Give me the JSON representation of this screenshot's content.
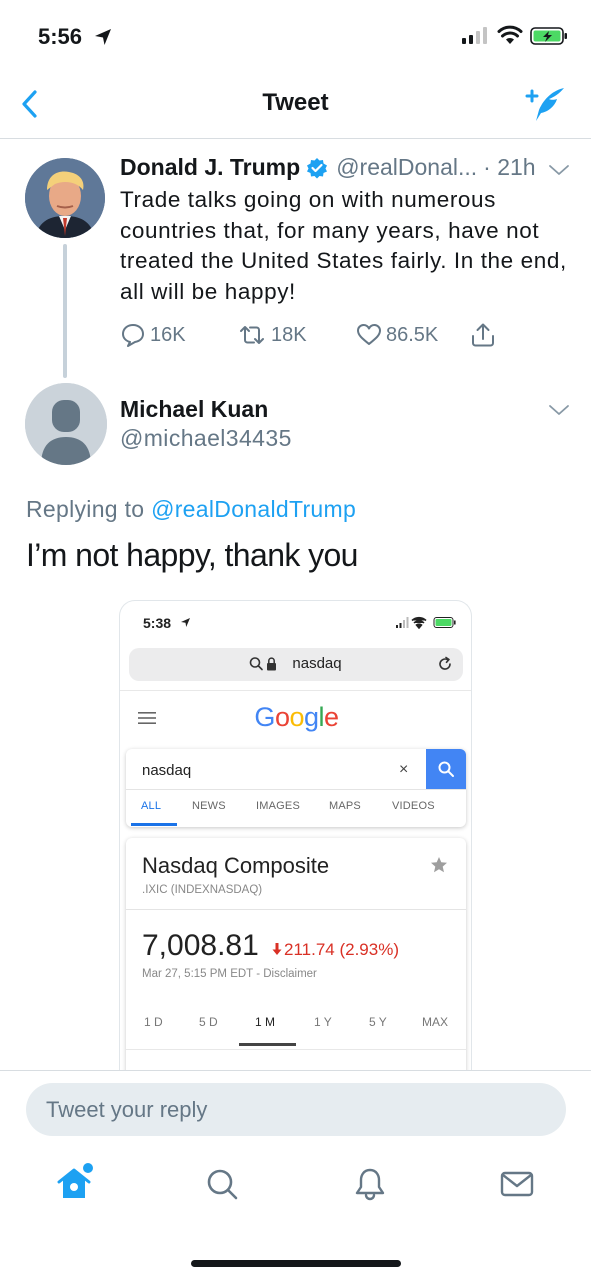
{
  "status_bar": {
    "time": "5:56",
    "icons": [
      "location-arrow-icon",
      "signal-icon",
      "wifi-icon",
      "battery-charging-icon"
    ]
  },
  "nav": {
    "title": "Tweet",
    "back_icon": "chevron-left-icon",
    "compose_icon": "compose-tweet-icon"
  },
  "tweet": {
    "name": "Donald J. Trump",
    "verified": true,
    "handle": "@realDonal...",
    "time": "· 21h",
    "text": "Trade talks going on with numerous countries that, for many years, have not treated the United States fairly. In the end, all will be happy!",
    "replies": "16K",
    "retweets": "18K",
    "likes": "86.5K"
  },
  "reply": {
    "name": "Michael Kuan",
    "handle": "@michael34435",
    "replying_prefix": "Replying to",
    "replying_to": "@realDonaldTrump",
    "text": "I’m not happy, thank you"
  },
  "media": {
    "time": "5:38",
    "url": "nasdaq",
    "logo": [
      "G",
      "o",
      "o",
      "g",
      "l",
      "e"
    ],
    "logo_colors": [
      "#4285f4",
      "#ea4335",
      "#fbbc05",
      "#4285f4",
      "#34a853",
      "#ea4335"
    ],
    "search_query": "nasdaq",
    "clear": "×",
    "tabs": [
      "ALL",
      "NEWS",
      "IMAGES",
      "MAPS",
      "VIDEOS"
    ],
    "active_tab": "ALL",
    "stock_name": "Nasdaq Composite",
    "ticker": ".IXIC (INDEXNASDAQ)",
    "price": "7,008.81",
    "change": "211.74 (2.93%)",
    "change_color": "#d93025",
    "date": "Mar 27, 5:15 PM EDT - Disclaimer",
    "ranges": [
      "1 D",
      "5 D",
      "1 M",
      "1 Y",
      "5 Y",
      "MAX"
    ],
    "active_range": "1 M"
  },
  "reply_bar": {
    "placeholder": "Tweet your reply"
  },
  "tab_bar": {
    "items": [
      "home-icon",
      "search-icon",
      "notifications-icon",
      "messages-icon"
    ],
    "active": "home-icon",
    "accent": "#1da1f2"
  }
}
